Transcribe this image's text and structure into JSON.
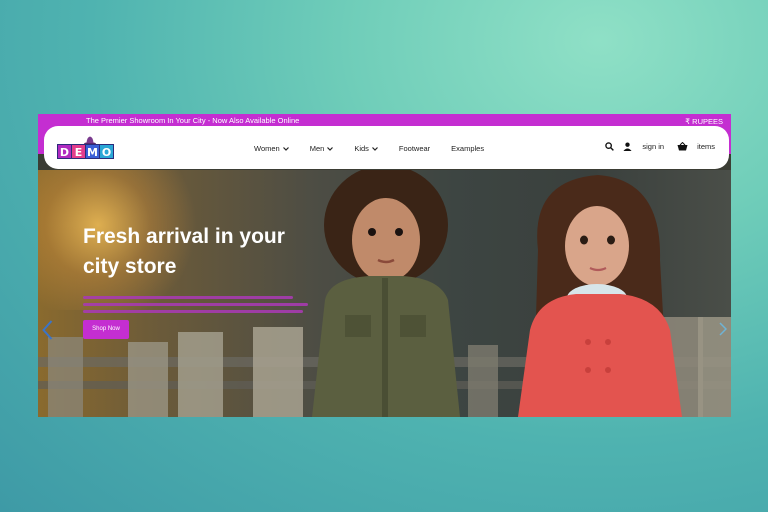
{
  "topbar": {
    "promo": "The Premier Showroom In Your City - Now Also Available Online",
    "currency": "₹ RUPEES"
  },
  "logo": {
    "letters": [
      "D",
      "E",
      "M",
      "O"
    ],
    "colors": [
      "#b02ac0",
      "#e33d8c",
      "#3b5fd6",
      "#2aa7d6"
    ]
  },
  "nav": {
    "items": [
      {
        "label": "Women",
        "has_dropdown": true
      },
      {
        "label": "Men",
        "has_dropdown": true
      },
      {
        "label": "Kids",
        "has_dropdown": true
      },
      {
        "label": "Footwear",
        "has_dropdown": false
      },
      {
        "label": "Examples",
        "has_dropdown": false
      }
    ],
    "signin": "sign in",
    "cart_label": "items",
    "icons": {
      "search": "search-icon",
      "user": "user-icon",
      "cart": "basket-icon"
    }
  },
  "hero": {
    "title": "Fresh arrival in your city store",
    "button": "Shop Now"
  },
  "colors": {
    "brand": "#c42ed1",
    "arrow": "#3a74c9"
  }
}
